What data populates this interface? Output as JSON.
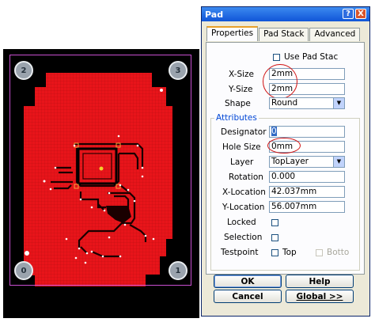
{
  "pcb": {
    "corner_pads": [
      "2",
      "3",
      "0",
      "1"
    ],
    "colors": {
      "board": "#e8141a",
      "outline": "#c84fd0",
      "trace": "#000000",
      "pad": "#9aa3ad"
    }
  },
  "dialog": {
    "title": "Pad",
    "title_buttons": {
      "help": "?",
      "close": "X"
    },
    "tabs": [
      "Properties",
      "Pad Stack",
      "Advanced"
    ],
    "use_pad_stack": {
      "label": "Use Pad Stac",
      "checked": false
    },
    "x_size": {
      "label": "X-Size",
      "value": "2mm"
    },
    "y_size": {
      "label": "Y-Size",
      "value": "2mm"
    },
    "shape": {
      "label": "Shape",
      "value": "Round"
    },
    "attributes": {
      "title": "Attributes",
      "designator": {
        "label": "Designator",
        "value": "0"
      },
      "hole_size": {
        "label": "Hole Size",
        "value": "0mm"
      },
      "layer": {
        "label": "Layer",
        "value": "TopLayer"
      },
      "rotation": {
        "label": "Rotation",
        "value": "0.000"
      },
      "x_location": {
        "label": "X-Location",
        "value": "42.037mm"
      },
      "y_location": {
        "label": "Y-Location",
        "value": "56.007mm"
      },
      "locked": {
        "label": "Locked"
      },
      "selection": {
        "label": "Selection"
      },
      "testpoint": {
        "label": "Testpoint",
        "top": "Top",
        "bottom": "Botto"
      }
    },
    "buttons": {
      "ok": "OK",
      "help": "Help",
      "cancel": "Cancel",
      "global": "Global >>"
    }
  }
}
